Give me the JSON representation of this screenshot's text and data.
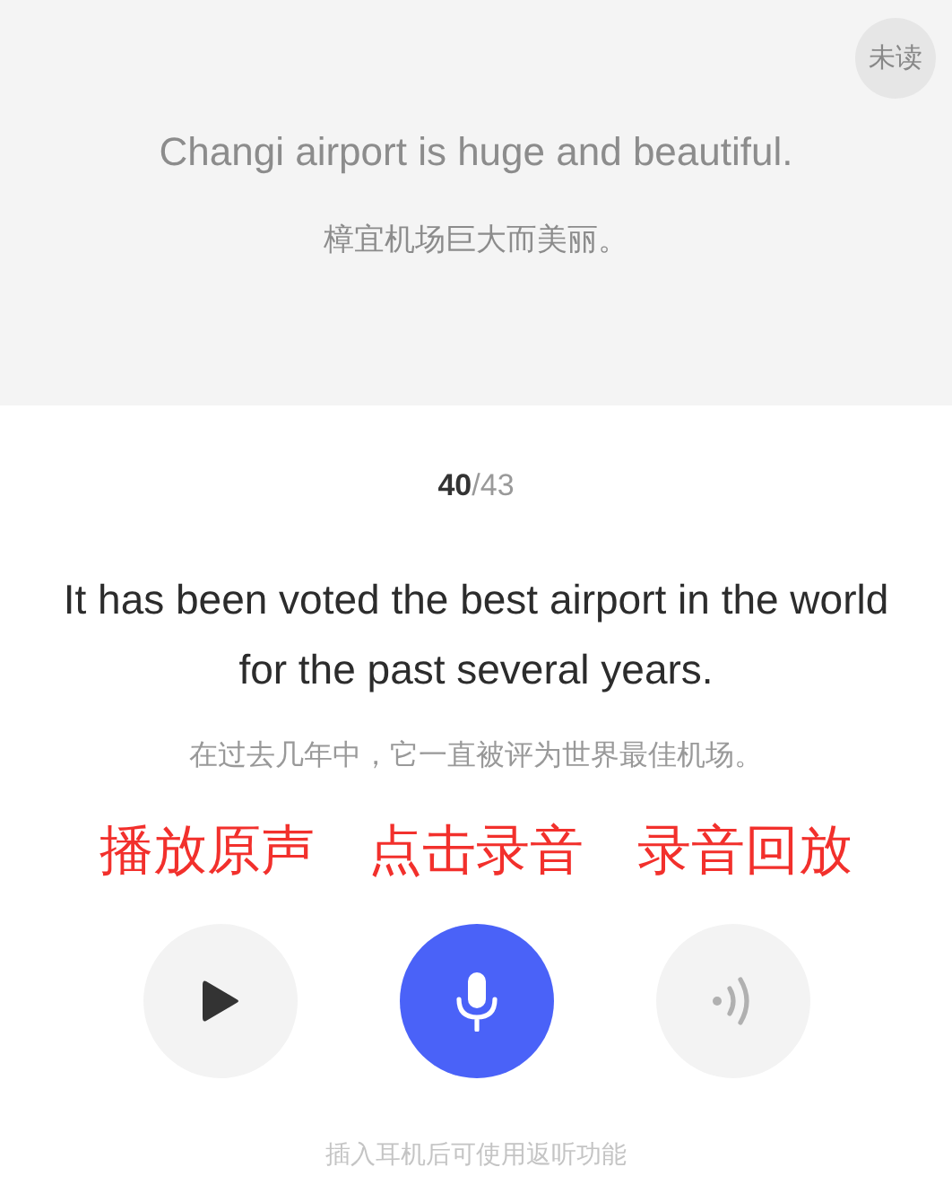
{
  "previous": {
    "badge": "未读",
    "sentence": "Changi airport is huge and beautiful.",
    "translation": "樟宜机场巨大而美丽。"
  },
  "counter": {
    "current": "40",
    "rest": "/43"
  },
  "sentence": "It has been voted the best airport in the world for the past several years.",
  "translation": "在过去几年中，它一直被评为世界最佳机场。",
  "annotations": [
    "播放原声",
    "点击录音",
    "录音回放"
  ],
  "controls": [
    {
      "kind": "play",
      "disabled": false
    },
    {
      "kind": "record",
      "disabled": false
    },
    {
      "kind": "playback",
      "disabled": true
    }
  ],
  "hint": "插入耳机后可使用返听功能"
}
